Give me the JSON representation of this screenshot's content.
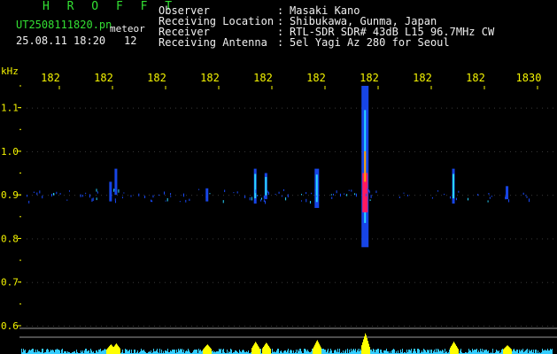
{
  "header": {
    "title": "H R O F F T",
    "filename": "UT2508111820.pn",
    "tag": "meteor",
    "datetime": "25.08.11 18:20",
    "count": "12"
  },
  "meta": {
    "rows": [
      {
        "label": "Observer",
        "value": "Masaki Kano"
      },
      {
        "label": "Receiving Location",
        "value": "Shibukawa, Gunma, Japan"
      },
      {
        "label": "Receiver",
        "value": "RTL-SDR SDR# 43dB L15 96.7MHz CW"
      },
      {
        "label": "Receiving Antenna",
        "value": "5el Yagi Az 280 for Seoul"
      }
    ]
  },
  "axis": {
    "y_unit": "kHz",
    "y_ticks": [
      "1.1",
      "1.0",
      "0.9",
      "0.8",
      "0.7",
      "0.6"
    ],
    "x_ticks": [
      "182",
      "182",
      "182",
      "182",
      "182",
      "182",
      "182",
      "182",
      "182",
      "1830"
    ]
  },
  "colors": {
    "text_green": "#33e033",
    "text_white": "#f0f0f0",
    "axis_yellow": "#f4f400",
    "echo_red": "#ff1a60",
    "echo_blue": "#1a4cff",
    "echo_cyan": "#29d6ff",
    "level_cyan": "#33ccff",
    "level_yellow": "#ffff00"
  },
  "chart_data": {
    "type": "heatmap",
    "x_ticks": [
      "182",
      "182",
      "182",
      "182",
      "182",
      "182",
      "182",
      "182",
      "182",
      "1830"
    ],
    "y_ticks": [
      "1.1",
      "1.0",
      "0.9",
      "0.8",
      "0.7",
      "0.6"
    ],
    "ylabel": "kHz",
    "ylim": [
      0.6,
      1.15
    ],
    "grid": true,
    "echoes": [
      {
        "t": 0.17,
        "f0": 0.885,
        "f1": 0.93,
        "intensity": 0.35
      },
      {
        "t": 0.18,
        "f0": 0.9,
        "f1": 0.96,
        "intensity": 0.4
      },
      {
        "t": 0.35,
        "f0": 0.885,
        "f1": 0.915,
        "intensity": 0.35
      },
      {
        "t": 0.44,
        "f0": 0.88,
        "f1": 0.96,
        "intensity": 0.5
      },
      {
        "t": 0.46,
        "f0": 0.89,
        "f1": 0.95,
        "intensity": 0.45
      },
      {
        "t": 0.555,
        "f0": 0.87,
        "f1": 0.96,
        "intensity": 0.6
      },
      {
        "t": 0.645,
        "f0": 0.78,
        "f1": 1.15,
        "intensity": 1.0
      },
      {
        "t": 0.81,
        "f0": 0.88,
        "f1": 0.96,
        "intensity": 0.5
      },
      {
        "t": 0.91,
        "f0": 0.89,
        "f1": 0.92,
        "intensity": 0.3
      }
    ]
  }
}
